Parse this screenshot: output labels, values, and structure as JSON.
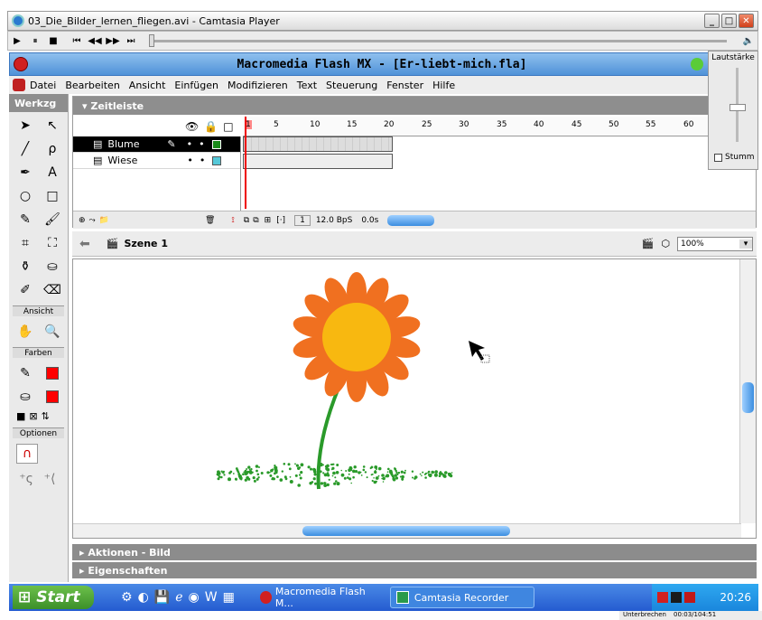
{
  "player": {
    "title": "03_Die_Bilder_lernen_fliegen.avi - Camtasia Player",
    "controls": [
      "▶",
      "⏸",
      "■",
      "⏮",
      "◀◀",
      "▶▶",
      "⏭"
    ],
    "volume_label": "Lautstärke",
    "mute_label": "Stumm"
  },
  "flash": {
    "title": "Macromedia Flash MX - [Er-liebt-mich.fla]",
    "menu": [
      "Datei",
      "Bearbeiten",
      "Ansicht",
      "Einfügen",
      "Modifizieren",
      "Text",
      "Steuerung",
      "Fenster",
      "Hilfe"
    ]
  },
  "toolbox": {
    "header": "Werkzg",
    "sections": {
      "view": "Ansicht",
      "colors": "Farben",
      "options": "Optionen"
    },
    "stroke_color": "#ff0000",
    "fill_color": "#ff0000"
  },
  "timeline": {
    "header": "Zeitleiste",
    "ruler": [
      "1",
      "5",
      "10",
      "15",
      "20",
      "25",
      "30",
      "35",
      "40",
      "45",
      "50",
      "55",
      "60"
    ],
    "layers": [
      {
        "name": "Blume",
        "selected": true,
        "color": "#1a8a1a"
      },
      {
        "name": "Wiese",
        "selected": false,
        "color": "#55c8d8"
      }
    ],
    "status": {
      "frame": "1",
      "fps": "12.0 BpS",
      "time": "0.0s"
    }
  },
  "scene": {
    "label": "Szene 1",
    "zoom": "100%"
  },
  "panels": {
    "actions": "Aktionen - Bild",
    "properties": "Eigenschaften"
  },
  "taskbar": {
    "start": "Start",
    "tasks": [
      "Macromedia Flash M...",
      "Camtasia Recorder"
    ],
    "clock": "20:26",
    "status_left": "Unterbrechen",
    "status_right": "00:03/104:51"
  },
  "colors": {
    "petal": "#f07020",
    "center": "#f8b810",
    "stem": "#2a9a2a",
    "grass": "#2a9a2a"
  }
}
